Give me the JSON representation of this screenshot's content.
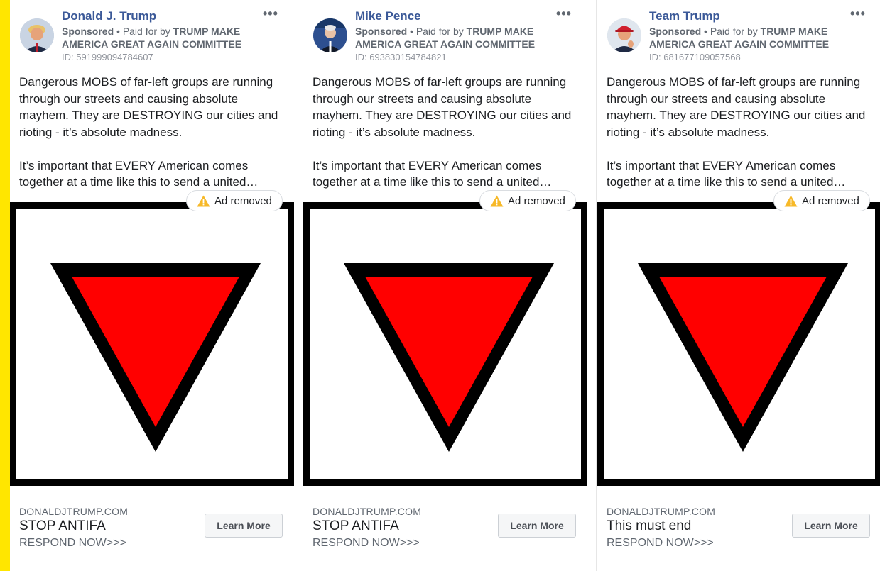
{
  "cards": [
    {
      "advertiser": "Donald J. Trump",
      "sponsored_label": "Sponsored",
      "paid_for_prefix": "Paid for by",
      "paid_for_by": "TRUMP MAKE AMERICA GREAT AGAIN COMMITTEE",
      "ad_id": "ID: 591999094784607",
      "body_paragraphs": [
        "Dangerous MOBS of far-left groups are running through our streets and causing absolute mayhem. They are DESTROYING our cities and rioting - it’s absolute madness.",
        "It’s important that EVERY American comes together at a time like this to send a united…"
      ],
      "status_badge": "Ad removed",
      "link_domain": "DONALDJTRUMP.COM",
      "headline": "STOP ANTIFA",
      "description": "RESPOND NOW>>>",
      "cta_label": "Learn More",
      "avatar_icon": "person-avatar-icon"
    },
    {
      "advertiser": "Mike Pence",
      "sponsored_label": "Sponsored",
      "paid_for_prefix": "Paid for by",
      "paid_for_by": "TRUMP MAKE AMERICA GREAT AGAIN COMMITTEE",
      "ad_id": "ID: 693830154784821",
      "body_paragraphs": [
        "Dangerous MOBS of far-left groups are running through our streets and causing absolute mayhem. They are DESTROYING our cities and rioting - it’s absolute madness.",
        "It’s important that EVERY American comes together at a time like this to send a united…"
      ],
      "status_badge": "Ad removed",
      "link_domain": "DONALDJTRUMP.COM",
      "headline": "STOP ANTIFA",
      "description": "RESPOND NOW>>>",
      "cta_label": "Learn More",
      "avatar_icon": "person-avatar-icon"
    },
    {
      "advertiser": "Team Trump",
      "sponsored_label": "Sponsored",
      "paid_for_prefix": "Paid for by",
      "paid_for_by": "TRUMP MAKE AMERICA GREAT AGAIN COMMITTEE",
      "ad_id": "ID: 681677109057568",
      "body_paragraphs": [
        "Dangerous MOBS of far-left groups are running through our streets and causing absolute mayhem. They are DESTROYING our cities and rioting - it’s absolute madness.",
        "It’s important that EVERY American comes together at a time like this to send a united…"
      ],
      "status_badge": "Ad removed",
      "link_domain": "DONALDJTRUMP.COM",
      "headline": "This must end",
      "description": "RESPOND NOW>>>",
      "cta_label": "Learn More",
      "avatar_icon": "person-avatar-icon"
    }
  ],
  "icons": {
    "more_options": "more-options-icon",
    "warning": "warning-icon"
  },
  "colors": {
    "accent_bar": "#ffe600",
    "advertiser_name": "#3b5998",
    "triangle_fill": "#ff0000",
    "triangle_outline": "#000000",
    "warning": "#f7b928"
  }
}
